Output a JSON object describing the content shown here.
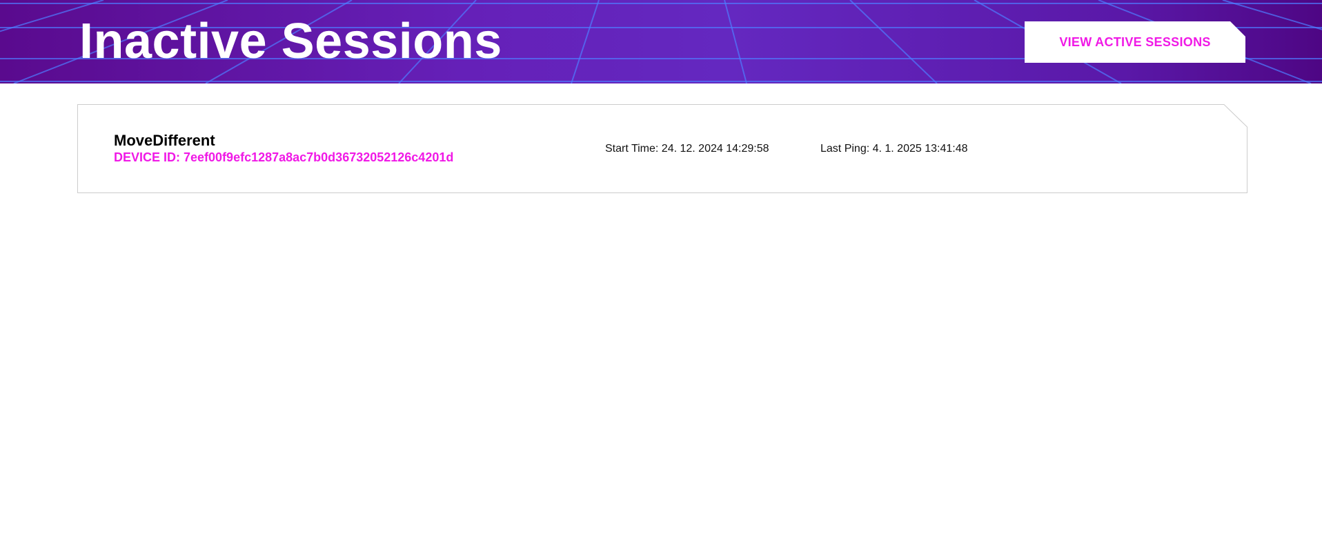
{
  "header": {
    "title": "Inactive Sessions",
    "view_active_label": "VIEW ACTIVE SESSIONS"
  },
  "colors": {
    "header_bg": "#6020b4",
    "grid_lines": "#4f7cff",
    "accent": "#f019e6",
    "card_border": "#cccccc"
  },
  "sessions": [
    {
      "name": "MoveDifferent",
      "device_id": "DEVICE ID: 7eef00f9efc1287a8ac7b0d36732052126c4201d",
      "start_time": "Start Time: 24. 12. 2024 14:29:58",
      "last_ping": "Last Ping: 4. 1. 2025 13:41:48"
    }
  ]
}
